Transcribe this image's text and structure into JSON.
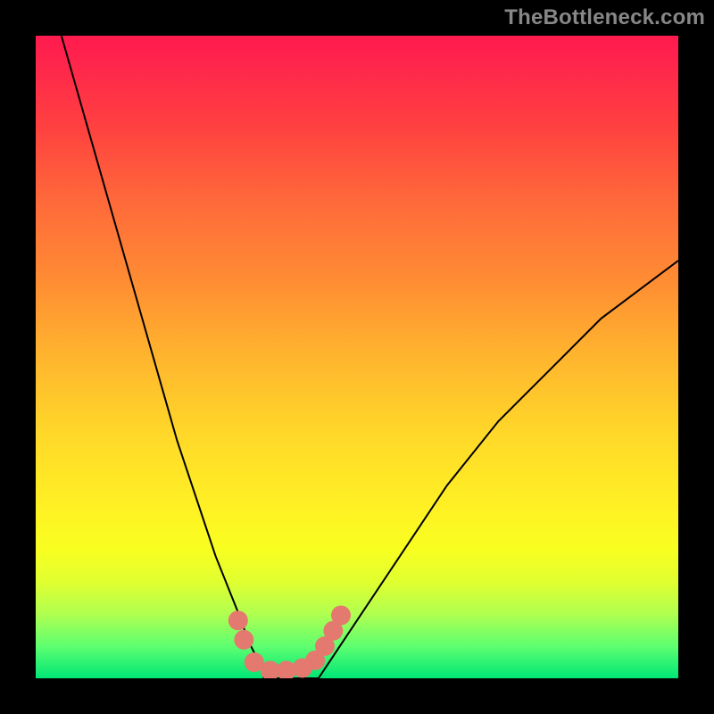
{
  "attribution": "TheBottleneck.com",
  "chart_data": {
    "type": "line",
    "title": "",
    "xlabel": "",
    "ylabel": "",
    "xlim": [
      0,
      100
    ],
    "ylim": [
      0,
      100
    ],
    "series": [
      {
        "name": "left-branch",
        "x": [
          4,
          6,
          8,
          10,
          12,
          14,
          16,
          18,
          20,
          22,
          24,
          26,
          28,
          30,
          32,
          33,
          34,
          35,
          35.5
        ],
        "y": [
          100,
          93,
          86,
          79,
          72,
          65,
          58,
          51,
          44,
          37,
          31,
          25,
          19,
          14,
          9,
          6,
          4,
          2,
          0
        ]
      },
      {
        "name": "valley-floor",
        "x": [
          35.5,
          38,
          41,
          44
        ],
        "y": [
          0,
          0,
          0,
          0
        ]
      },
      {
        "name": "right-branch",
        "x": [
          44,
          46,
          48,
          52,
          56,
          60,
          64,
          68,
          72,
          76,
          80,
          84,
          88,
          92,
          96,
          100
        ],
        "y": [
          0,
          3,
          6,
          12,
          18,
          24,
          30,
          35,
          40,
          44,
          48,
          52,
          56,
          59,
          62,
          65
        ]
      }
    ],
    "markers": {
      "name": "highlight-points",
      "color": "#e4796f",
      "points": [
        {
          "x": 31.5,
          "y": 9
        },
        {
          "x": 32.4,
          "y": 6
        },
        {
          "x": 34.0,
          "y": 2.5
        },
        {
          "x": 36.5,
          "y": 1.2
        },
        {
          "x": 39.0,
          "y": 1.2
        },
        {
          "x": 41.5,
          "y": 1.6
        },
        {
          "x": 43.5,
          "y": 2.8
        },
        {
          "x": 45.0,
          "y": 5.0
        },
        {
          "x": 46.3,
          "y": 7.4
        },
        {
          "x": 47.5,
          "y": 9.8
        }
      ]
    },
    "background_gradient": {
      "top": "#ff1a4f",
      "mid": "#ffe626",
      "bottom": "#00e676"
    }
  }
}
